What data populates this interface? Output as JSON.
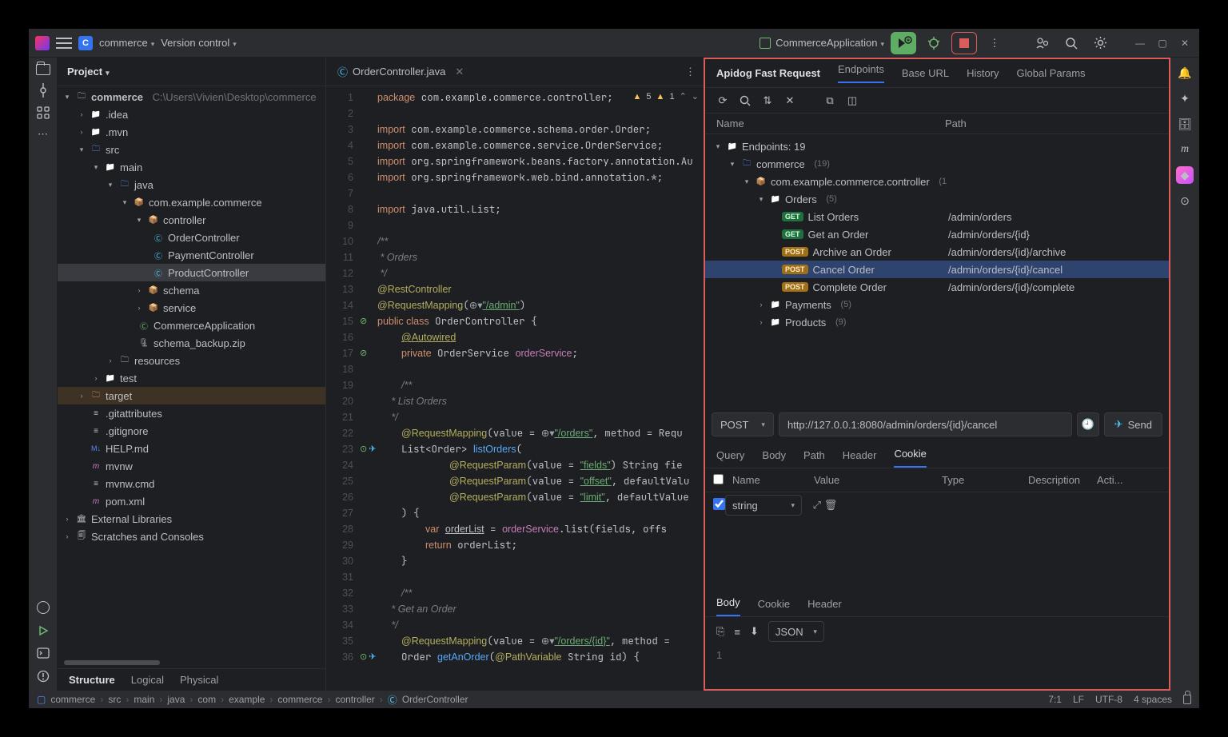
{
  "titlebar": {
    "project": "commerce",
    "vcs": "Version control",
    "runconfig": "CommerceApplication"
  },
  "projectPanel": {
    "title": "Project",
    "root": "commerce",
    "rootPath": "C:\\Users\\Vivien\\Desktop\\commerce",
    "nodes": {
      "idea": ".idea",
      "mvn": ".mvn",
      "src": "src",
      "main": "main",
      "java": "java",
      "pkg": "com.example.commerce",
      "controller": "controller",
      "oc": "OrderController",
      "pc": "PaymentController",
      "prc": "ProductController",
      "schema": "schema",
      "service": "service",
      "app": "CommerceApplication",
      "zip": "schema_backup.zip",
      "resources": "resources",
      "test": "test",
      "target": "target",
      "gattr": ".gitattributes",
      "gign": ".gitignore",
      "help": "HELP.md",
      "mvnw": "mvnw",
      "mvnwcmd": "mvnw.cmd",
      "pom": "pom.xml",
      "ext": "External Libraries",
      "scratch": "Scratches and Consoles"
    },
    "views": {
      "structure": "Structure",
      "logical": "Logical",
      "physical": "Physical"
    }
  },
  "editor": {
    "tab": "OrderController.java",
    "warnA": "5",
    "warnB": "1",
    "g": [
      "1",
      "2",
      "3",
      "4",
      "5",
      "6",
      "7",
      "8",
      "9",
      "10",
      "11",
      "12",
      "13",
      "14",
      "15",
      "16",
      "17",
      "18",
      "19",
      "20",
      "21",
      "22",
      "23",
      "24",
      "25",
      "26",
      "27",
      "28",
      "29",
      "30",
      "31",
      "32",
      "33",
      "34",
      "35",
      "36"
    ]
  },
  "apidog": {
    "tabs": {
      "fast": "Apidog Fast Request",
      "endpoints": "Endpoints",
      "base": "Base URL",
      "history": "History",
      "globals": "Global Params"
    },
    "cols": {
      "name": "Name",
      "path": "Path"
    },
    "root": "Endpoints: 19",
    "module": "commerce",
    "moduleCnt": "(19)",
    "pkg": "com.example.commerce.controller",
    "pkgCnt": "(1",
    "orders": "Orders",
    "ordersCnt": "(5)",
    "eps": [
      {
        "m": "GET",
        "n": "List Orders",
        "p": "/admin/orders"
      },
      {
        "m": "GET",
        "n": "Get an Order",
        "p": "/admin/orders/{id}"
      },
      {
        "m": "POST",
        "n": "Archive an Order",
        "p": "/admin/orders/{id}/archive"
      },
      {
        "m": "POST",
        "n": "Cancel Order",
        "p": "/admin/orders/{id}/cancel"
      },
      {
        "m": "POST",
        "n": "Complete Order",
        "p": "/admin/orders/{id}/complete"
      }
    ],
    "payments": "Payments",
    "paymentsCnt": "(5)",
    "products": "Products",
    "productsCnt": "(9)",
    "method": "POST",
    "url": "http://127.0.0.1:8080/admin/orders/{id}/cancel",
    "send": "Send",
    "ptabs": {
      "q": "Query",
      "b": "Body",
      "p": "Path",
      "h": "Header",
      "c": "Cookie"
    },
    "phead": {
      "name": "Name",
      "value": "Value",
      "type": "Type",
      "desc": "Description",
      "act": "Acti..."
    },
    "typeSel": "string",
    "rtabs": {
      "b": "Body",
      "c": "Cookie",
      "h": "Header"
    },
    "respFmt": "JSON",
    "respLine": "1"
  },
  "breadcrumb": [
    "commerce",
    "src",
    "main",
    "java",
    "com",
    "example",
    "commerce",
    "controller",
    "OrderController"
  ],
  "status": {
    "pos": "7:1",
    "lf": "LF",
    "enc": "UTF-8",
    "indent": "4 spaces"
  }
}
